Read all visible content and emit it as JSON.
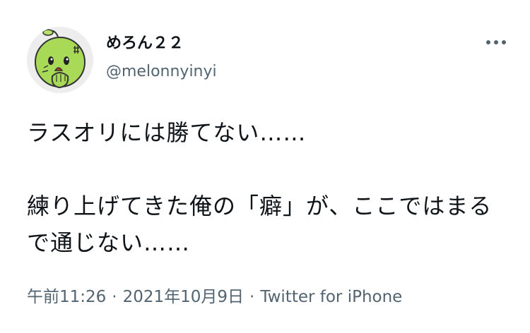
{
  "user": {
    "display_name": "めろん２２",
    "handle": "@melonnyinyi",
    "avatar_icon": "melon-character-avatar-icon"
  },
  "more_icon": "more-horizontal-icon",
  "tweet": {
    "text": "ラスオリには勝てない……\n\n練り上げてきた俺の「癖」が、ここではまるで通じない……"
  },
  "meta": {
    "time": "午前11:26",
    "separator": "·",
    "date": "2021年10月9日",
    "source": "Twitter for iPhone"
  },
  "colors": {
    "primary_text": "#0f1419",
    "secondary_text": "#536471",
    "avatar_green": "#9fd64a"
  }
}
